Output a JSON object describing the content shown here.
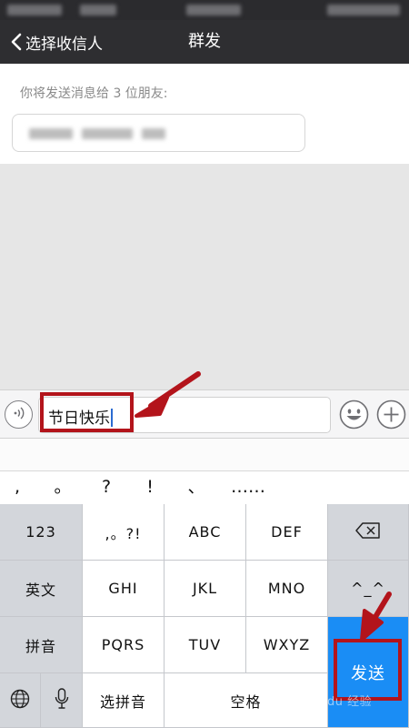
{
  "nav": {
    "back_label": "选择收信人",
    "title": "群发"
  },
  "recipients": {
    "hint": "你将发送消息给 3 位朋友:"
  },
  "input": {
    "text": "节日快乐"
  },
  "candidates": [
    ",",
    "。",
    "?",
    "!",
    "、",
    "……"
  ],
  "keyboard": {
    "k123": "123",
    "punct": ",。?!",
    "abc": "ABC",
    "def": "DEF",
    "english": "英文",
    "ghi": "GHI",
    "jkl": "JKL",
    "mno": "MNO",
    "emoticon": "^_^",
    "pinyin": "拼音",
    "pqrs": "PQRS",
    "tuv": "TUV",
    "wxyz": "WXYZ",
    "send": "发送",
    "choose_pinyin": "选拼音",
    "space": "空格"
  },
  "icons": {
    "back": "chevron-left-icon",
    "voice": "voice-wave-icon",
    "emoji": "smiley-icon",
    "plus": "plus-circle-icon",
    "backspace": "backspace-icon",
    "globe": "globe-icon",
    "mic": "microphone-icon"
  },
  "colors": {
    "nav_bg": "#2e2e31",
    "send_key": "#1a8df5",
    "annotation": "#b3141b",
    "caret": "#2a6bd1"
  }
}
